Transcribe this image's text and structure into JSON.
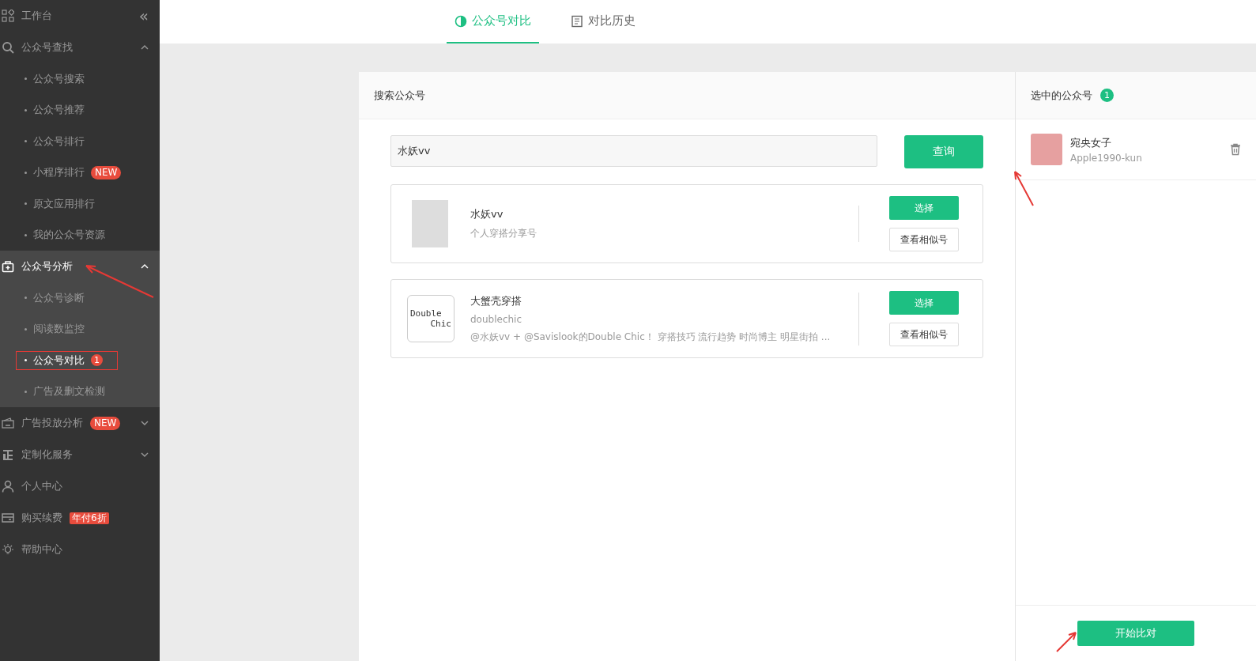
{
  "sidebar": {
    "items": [
      {
        "kind": "item",
        "label": "工作台",
        "collapse": "«"
      },
      {
        "kind": "group",
        "label": "公众号查找",
        "expanded": true,
        "selected": false,
        "children": [
          {
            "label": "公众号搜索",
            "selected": false
          },
          {
            "label": "公众号推荐",
            "selected": false
          },
          {
            "label": "公众号排行",
            "selected": false
          },
          {
            "label": "小程序排行",
            "badge": "NEW",
            "selected": false
          },
          {
            "label": "原文应用排行",
            "selected": false
          },
          {
            "label": "我的公众号资源",
            "selected": false
          }
        ]
      },
      {
        "kind": "group",
        "label": "公众号分析",
        "expanded": true,
        "selected": true,
        "children": [
          {
            "label": "公众号诊断",
            "selected": false
          },
          {
            "label": "阅读数监控",
            "selected": false
          },
          {
            "label": "公众号对比",
            "badge": "1",
            "selected": true
          },
          {
            "label": "广告及删文检测",
            "selected": false
          }
        ]
      },
      {
        "kind": "group",
        "label": "广告投放分析",
        "badge": "NEW",
        "expanded": false,
        "selected": false
      },
      {
        "kind": "group",
        "label": "定制化服务",
        "expanded": false,
        "selected": false
      },
      {
        "kind": "item",
        "label": "个人中心"
      },
      {
        "kind": "item",
        "label": "购买续费",
        "badge": "年付6折"
      },
      {
        "kind": "item",
        "label": "帮助中心"
      }
    ]
  },
  "tabs": [
    {
      "label": "公众号对比",
      "selected": true
    },
    {
      "label": "对比历史",
      "selected": false
    }
  ],
  "search_panel": {
    "title": "搜索公众号",
    "search": {
      "value": "水妖vv"
    },
    "button": "查询",
    "results": [
      {
        "kind": "photo",
        "name": "水妖vv",
        "description": "个人穿搭分享号",
        "select": "选择",
        "similar": "查看相似号"
      },
      {
        "kind": "logo",
        "logo_text": [
          "Double",
          "Chic"
        ],
        "name": "大蟹壳穿搭",
        "account": "doublechic",
        "description": "@水妖vv + @Savislook的Double Chic！ 穿搭技巧 流行趋势 时尚博主 明星街拍 ...",
        "select": "选择",
        "similar": "查看相似号"
      }
    ]
  },
  "selected_panel": {
    "title": "选中的公众号",
    "count": "1",
    "items": [
      {
        "name": "宛央女子",
        "account": "Apple1990-kun"
      }
    ],
    "start": "开始比对"
  }
}
